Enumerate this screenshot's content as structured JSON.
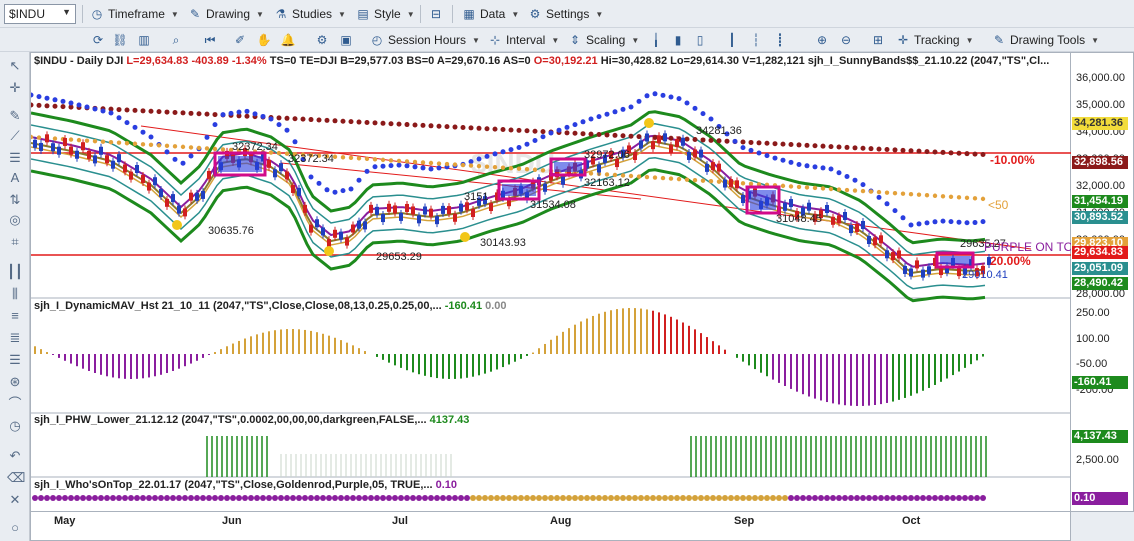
{
  "toolbar1": {
    "symbol": "$INDU",
    "timeframe": "Timeframe",
    "drawing": "Drawing",
    "studies": "Studies",
    "style": "Style",
    "data": "Data",
    "settings": "Settings"
  },
  "toolbar2": {
    "session_hours": "Session Hours",
    "interval": "Interval",
    "scaling": "Scaling",
    "tracking": "Tracking",
    "drawing_tools": "Drawing Tools"
  },
  "price_pane": {
    "header": {
      "symbol": "$INDU - Daily  DJI",
      "last": "L=29,634.83",
      "chg": "-403.89",
      "pct": "-1.34%",
      "rest": "TS=0  TE=DJI  B=29,577.03  BS=0  A=29,670.16  AS=0",
      "open": "O=30,192.21",
      "ohlc": "Hi=30,428.82  Lo=29,614.30  V=1,282,121  sjh_I_SunnyBands$$_21.10.22 (2047,\"TS\",Cl..."
    },
    "watermark": "$INDU",
    "annotations": {
      "a1": "30635.76",
      "a2": "32372.34",
      "a3": "32372.34",
      "a4": "29653.29",
      "a5": "30143.93",
      "a6": "31534.08",
      "a7": "3151",
      "a8": "32972.06",
      "a9": "32163.12",
      "a10": "34281.36",
      "a11": "31048.45",
      "a12": "29010.41",
      "a13": "29635.27"
    },
    "labels": {
      "minus10": "-10.00%",
      "lt50": "<50",
      "pct20": "20.00%",
      "purple": "PURPLE ON TO"
    }
  },
  "price_axis": {
    "ticks": [
      "36,000.00",
      "35,000.00",
      "34,000.00",
      "33,000.00",
      "32,000.00",
      "31,000.00",
      "30,000.00",
      "29,000.00",
      "28,000.00"
    ],
    "boxes": {
      "b1": "34,281.36",
      "b2": "32,898.56",
      "b3": "31,454.19",
      "b4": "30,893.52",
      "b5": "29,823.10",
      "b6": "29,634.83",
      "b7": "29,051.09",
      "b8": "28,490.42"
    }
  },
  "pane2": {
    "title": "sjh_I_DynamicMAV_Hst 21_10_11 (2047,\"TS\",Close,Close,08,13,0.25,0.25,00,...",
    "v1": "-160.41",
    "v2": "0.00",
    "ticks": [
      "250.00",
      "100.00",
      "-50.00",
      "-200.00"
    ],
    "box": "-160.41"
  },
  "pane3": {
    "title": "sjh_I_PHW_Lower_21.12.12 (2047,\"TS\",0.0002,00,00,00,darkgreen,FALSE,...",
    "v1": "4137.43",
    "ticks": [
      "2,500.00"
    ],
    "box": "4,137.43"
  },
  "pane4": {
    "title": "sjh_I_Who'sOnTop_22.01.17 (2047,\"TS\",Close,Goldenrod,Purple,05, TRUE,...",
    "v1": "0.10",
    "box": "0.10"
  },
  "xaxis": {
    "months": [
      "May",
      "Jun",
      "Jul",
      "Aug",
      "Sep",
      "Oct"
    ]
  },
  "colors": {
    "up": "#1f3fbf",
    "down": "#d11f1f",
    "red_line": "#e21a1a",
    "maroon_dots": "#8b1a1a",
    "blue_dots": "#2a3ee0",
    "orange_dots": "#e3a13a",
    "green_band": "#1d8a1d",
    "teal": "#2a8f8f",
    "purple": "#8a1e9e",
    "goldenrod": "#d4a23a"
  }
}
